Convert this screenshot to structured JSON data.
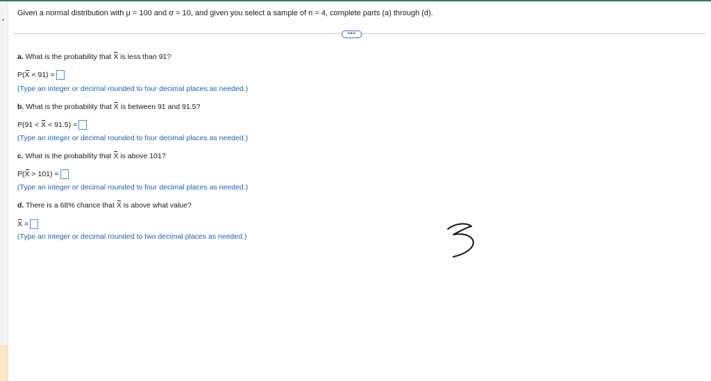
{
  "question": {
    "text_before_mu": "Given a normal distribution with ",
    "mu_symbol": "μ",
    "text_after_mu": " = 100 and ",
    "sigma_symbol": "σ",
    "text_after_sigma": " = 10, and given you select a sample of n = 4, complete parts (a) through (d)."
  },
  "more_button_label": "•••",
  "parts": {
    "a": {
      "label": "a.",
      "q_before": " What is the probability that ",
      "q_after": " is less than 91?",
      "expr_before": "P(",
      "expr_after": " < 91) =",
      "hint": "(Type an integer or decimal rounded to four decimal places as needed.)"
    },
    "b": {
      "label": "b.",
      "q_before": " What is the probability that ",
      "q_after": " is between 91 and 91.5?",
      "expr_before": "P(91 < ",
      "expr_after": " < 91.5) =",
      "hint": "(Type an integer or decimal rounded to four decimal places as needed.)"
    },
    "c": {
      "label": "c.",
      "q_before": " What is the probability that ",
      "q_after": " is above 101?",
      "expr_before": "P(",
      "expr_after": " > 101) =",
      "hint": "(Type an integer or decimal rounded to four decimal places as needed.)"
    },
    "d": {
      "label": "d.",
      "q_before": " There is a 68% chance that ",
      "q_after": " is above what value?",
      "expr_before": "",
      "expr_after": " =",
      "hint": "(Type an integer or decimal rounded to two decimal places as needed.)"
    }
  },
  "xbar_symbol": "X",
  "colors": {
    "accent_green": "#2f7d5a",
    "hint_blue": "#1f5fb8",
    "box_blue": "#4a8fd8"
  }
}
